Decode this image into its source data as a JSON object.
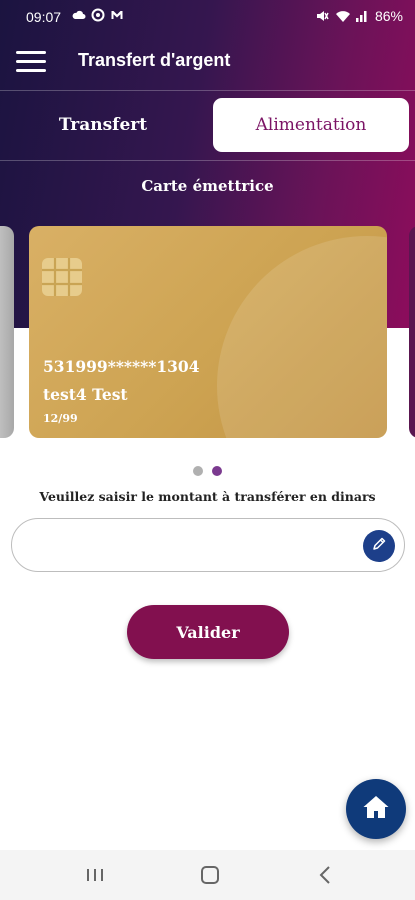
{
  "status_bar": {
    "time": "09:07",
    "battery": "86%",
    "left_icons": [
      "cloud-icon",
      "sync-icon",
      "gmail-icon"
    ],
    "right_icons": [
      "mute-icon",
      "wifi-icon",
      "signal-icon"
    ]
  },
  "header": {
    "title": "Transfert d'argent",
    "menu_icon": "hamburger-menu-icon"
  },
  "tabs": [
    {
      "label": "Transfert",
      "active": false
    },
    {
      "label": "Alimentation",
      "active": true
    }
  ],
  "section": {
    "title": "Carte émettrice"
  },
  "card": {
    "number": "531999******1304",
    "holder": "test4 Test",
    "expiry": "12/99"
  },
  "carousel": {
    "dot_count": 2,
    "active_index": 1
  },
  "amount": {
    "label": "Veuillez saisir le montant à transférer en dinars",
    "value": "",
    "placeholder": ""
  },
  "actions": {
    "submit_label": "Valider"
  },
  "colors": {
    "brand_primary": "#82104f",
    "accent_blue": "#0f3a7a",
    "tab_active_text": "#7b1465",
    "card_gold": "#cda352"
  }
}
